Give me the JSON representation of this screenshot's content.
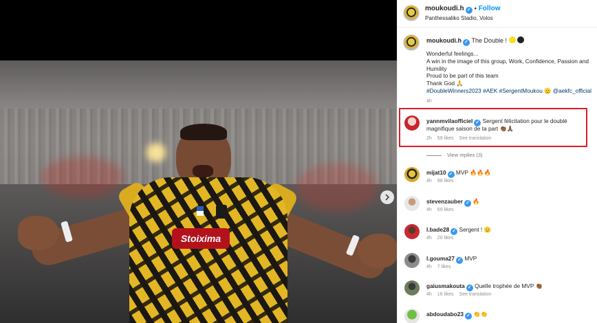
{
  "post": {
    "username": "moukoudi.h",
    "follow_label": "Follow",
    "location": "Panthessaliko Stadio, Volos",
    "sponsor_text": "Stoixima"
  },
  "caption": {
    "username": "moukoudi.h",
    "title": "The Double !",
    "lines": [
      "Wonderful feelings...",
      "A win in the image of this group, Work, Confidence, Passion and",
      "Humility",
      "Proud to be part of this team",
      "Thank God 🙏"
    ],
    "tags": "#DoubleWinners2023 #AEK #SergentMoukou 🫡 @aekfc_official",
    "time": "4h"
  },
  "highlighted_comment": {
    "username": "yannmvilaofficiel",
    "text_line1": "Sergent félicitation pour le doublé",
    "text_line2": "magnifique saison de ta part 👏🏾🙏🏾",
    "time": "2h",
    "likes": "59 likes",
    "see_translation": "See translation",
    "view_replies": "View replies (3)"
  },
  "comments": [
    {
      "username": "mijat10",
      "text": "MVP 🔥🔥🔥",
      "time": "4h",
      "likes": "98 likes",
      "see_translation": ""
    },
    {
      "username": "stevenzauber",
      "text": "🔥",
      "time": "4h",
      "likes": "69 likes",
      "see_translation": ""
    },
    {
      "username": "l.bade28",
      "text": "Sergent ! 🫡",
      "time": "4h",
      "likes": "20 likes",
      "see_translation": ""
    },
    {
      "username": "l.gouma27",
      "text": "MVP",
      "time": "4h",
      "likes": "7 likes",
      "see_translation": ""
    },
    {
      "username": "gaiusmakouta",
      "text": "Quelle trophée de MVP 👏🏾",
      "time": "4h",
      "likes": "16 likes",
      "see_translation": "See translation"
    },
    {
      "username": "abdoudabo23",
      "text": "👏👏",
      "time": "",
      "likes": "",
      "see_translation": ""
    }
  ]
}
